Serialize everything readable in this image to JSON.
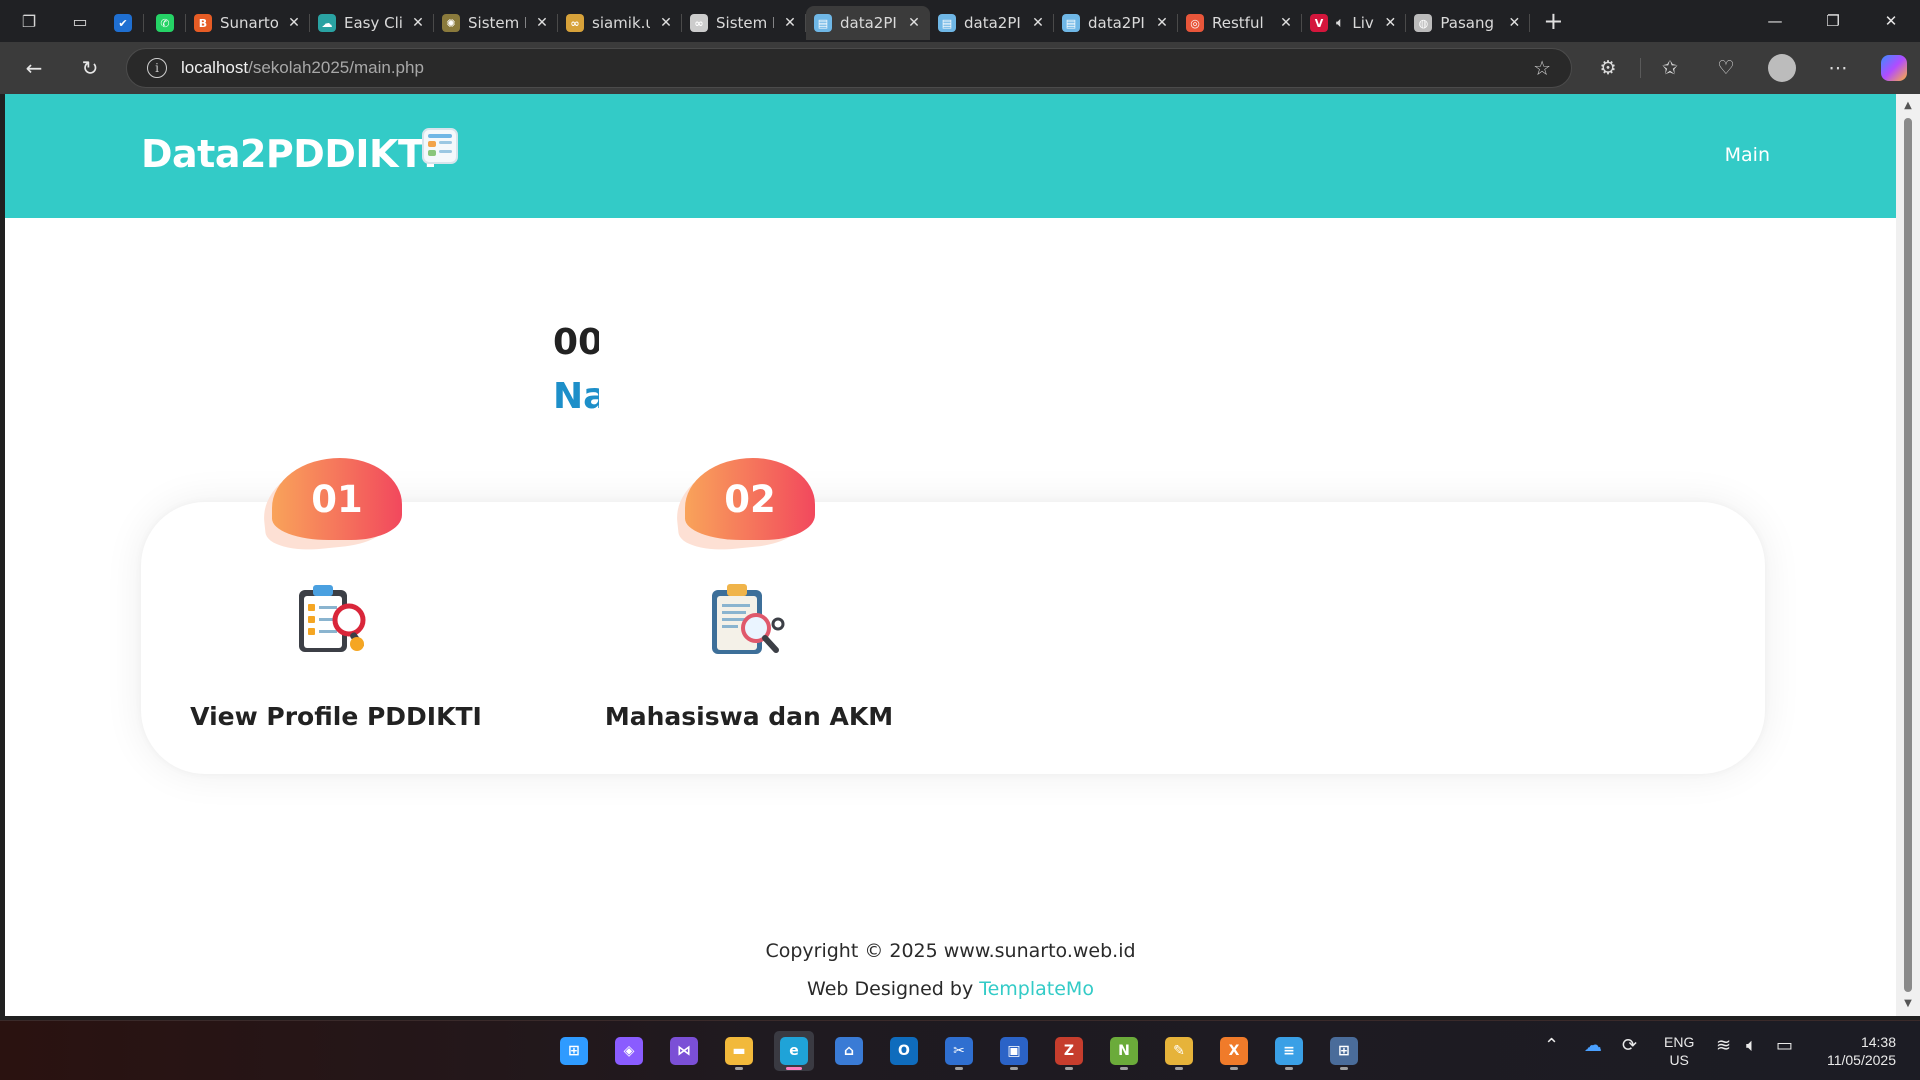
{
  "browser": {
    "tabs": [
      {
        "title": "",
        "favicon": "check-icon",
        "color": "#1f6fd1"
      },
      {
        "title": "",
        "favicon": "whatsapp-icon",
        "color": "#25d366"
      },
      {
        "title": "Sunarto",
        "favicon": "blogger-icon",
        "color": "#e65c25"
      },
      {
        "title": "Easy Cli",
        "favicon": "cloud-icon",
        "color": "#2aa3a3"
      },
      {
        "title": "Sistem I",
        "favicon": "emblem-icon",
        "color": "#8a7a3c"
      },
      {
        "title": "siamik.u",
        "favicon": "infinity-icon",
        "color": "#d7a23a"
      },
      {
        "title": "Sistem I",
        "favicon": "infinity-icon",
        "color": "#cccccc"
      },
      {
        "title": "data2PI",
        "favicon": "page-icon",
        "color": "#6fb7e6",
        "active": true
      },
      {
        "title": "data2PI",
        "favicon": "page-icon",
        "color": "#6fb7e6"
      },
      {
        "title": "data2PI",
        "favicon": "page-icon",
        "color": "#6fb7e6"
      },
      {
        "title": "Restful",
        "favicon": "api-icon",
        "color": "#e8563a"
      },
      {
        "title": "Liv",
        "favicon": "vivaldi-icon",
        "color": "#d4163c"
      },
      {
        "title": "Pasang",
        "favicon": "globe-icon",
        "color": "#bbbbbb"
      }
    ],
    "url_host": "localhost",
    "url_path": "/sekolah2025/main.php"
  },
  "page": {
    "brand": "Data2PDDIKTI",
    "nav_main": "Main",
    "hero_line1": "00",
    "hero_line2": "Na",
    "features": [
      {
        "number": "01",
        "title": "View Profile PDDIKTI",
        "icon": "clipboard-checklist-magnifier-icon"
      },
      {
        "number": "02",
        "title": "Mahasiswa dan AKM",
        "icon": "clipboard-document-search-icon"
      }
    ],
    "footer_copyright": "Copyright © 2025 www.sunarto.web.id",
    "footer_designed_prefix": "Web Designed by ",
    "footer_designed_link": "TemplateMo"
  },
  "colors": {
    "header_bg": "#33cbc7",
    "hero_accent": "#1d8fc9",
    "badge_gradient_start": "#f9a35a",
    "badge_gradient_end": "#f2485d",
    "link": "#33cbc7"
  },
  "taskbar": {
    "apps": [
      "windows-start-icon",
      "copilot-icon",
      "visual-studio-icon",
      "file-explorer-icon",
      "edge-icon",
      "store-icon",
      "outlook-icon",
      "snipping-icon",
      "remote-desktop-icon",
      "filezilla-icon",
      "notepad-plus-icon",
      "paint-icon",
      "xampp-icon",
      "notepad-icon",
      "calculator-icon"
    ],
    "language_line1": "ENG",
    "language_line2": "US",
    "time": "14:38",
    "date": "11/05/2025"
  }
}
